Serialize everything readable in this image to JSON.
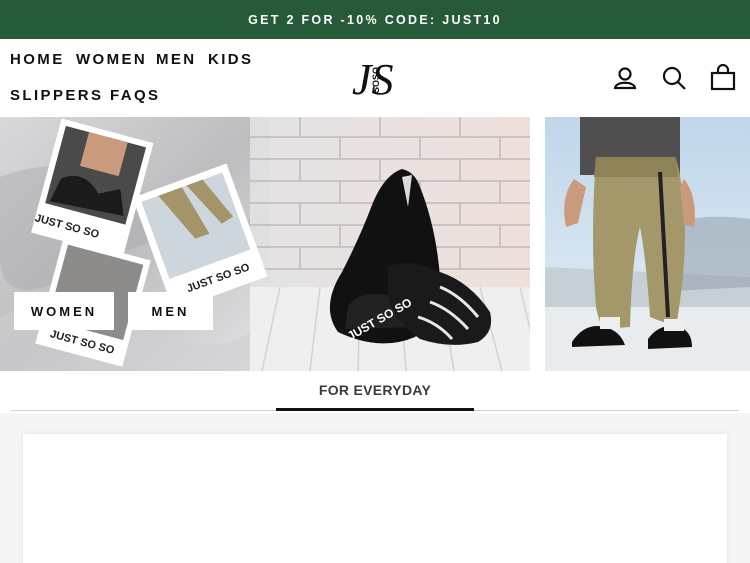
{
  "announcement": {
    "text": "GET 2 FOR -10% CODE: JUST10"
  },
  "nav": {
    "items": [
      "HOME",
      "WOMEN",
      "MEN",
      "KIDS",
      "SLIPPERS",
      "FAQS"
    ]
  },
  "logo": {
    "mark": "JS",
    "sub": "SOSO"
  },
  "header_icons": [
    "account-icon",
    "search-icon",
    "cart-icon"
  ],
  "hero": {
    "buttons": {
      "women": "WOMEN",
      "men": "MEN"
    },
    "photo_caption": "JUST SO SO",
    "shoe_print": "JUST SO SO"
  },
  "tabs": {
    "active": "FOR EVERYDAY"
  },
  "colors": {
    "announcement_bg": "#265a38",
    "text": "#111111"
  }
}
